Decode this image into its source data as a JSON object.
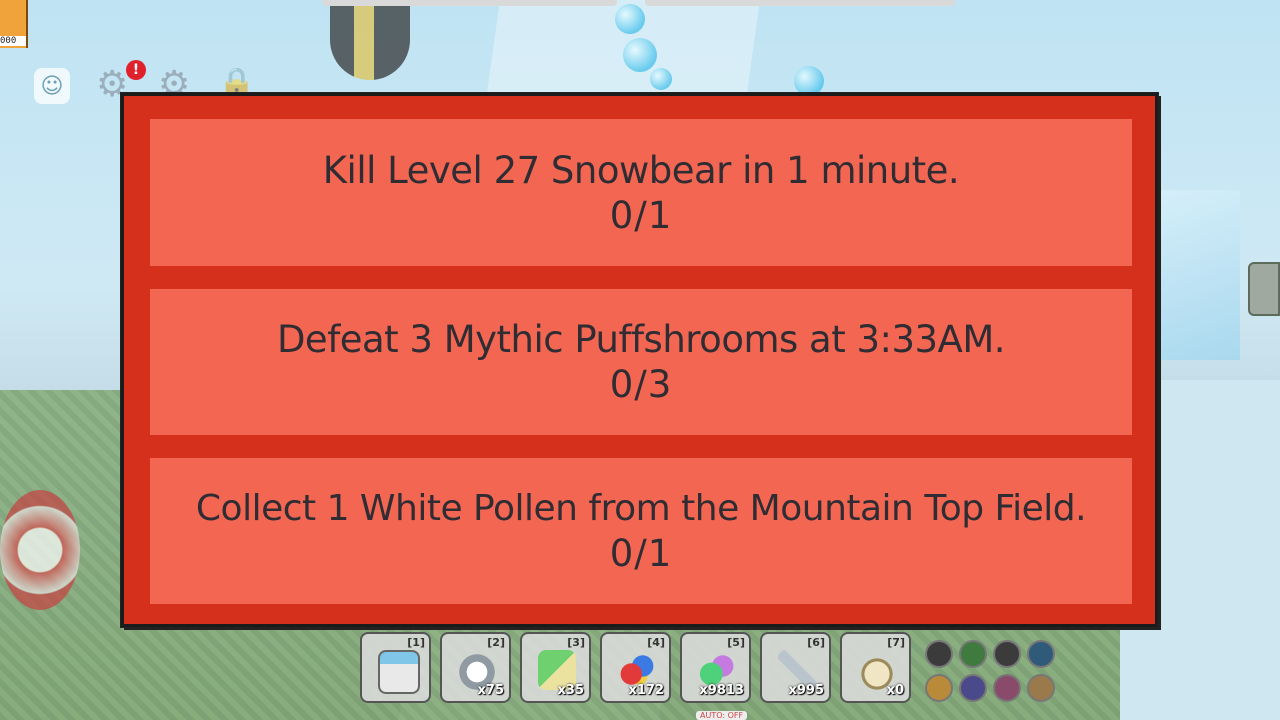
{
  "hud": {
    "honey_counter": "000",
    "alert_badge": "!",
    "auto_tag": "AUTO: OFF"
  },
  "quests": [
    {
      "title": "Kill Level 27 Snowbear in 1 minute.",
      "progress": "0/1"
    },
    {
      "title": "Defeat 3 Mythic Puffshrooms at 3:33AM.",
      "progress": "0/3"
    },
    {
      "title": "Collect 1 White Pollen from the Mountain Top Field.",
      "progress": "0/1"
    }
  ],
  "colors": {
    "panel_border": "#d4301c",
    "row_fill": "#f36752",
    "text": "#2f2c33"
  },
  "hotbar": [
    {
      "key": "[1]",
      "icon": "sprinkler-icon",
      "count": ""
    },
    {
      "key": "[2]",
      "icon": "cloud-vial-icon",
      "count": "x75"
    },
    {
      "key": "[3]",
      "icon": "field-dice-icon",
      "count": "x35"
    },
    {
      "key": "[4]",
      "icon": "glitter-icon",
      "count": "x172"
    },
    {
      "key": "[5]",
      "icon": "gumdrops-icon",
      "count": "x9813"
    },
    {
      "key": "[6]",
      "icon": "horn-icon",
      "count": "x995"
    },
    {
      "key": "[7]",
      "icon": "jar-icon",
      "count": "x0"
    }
  ]
}
